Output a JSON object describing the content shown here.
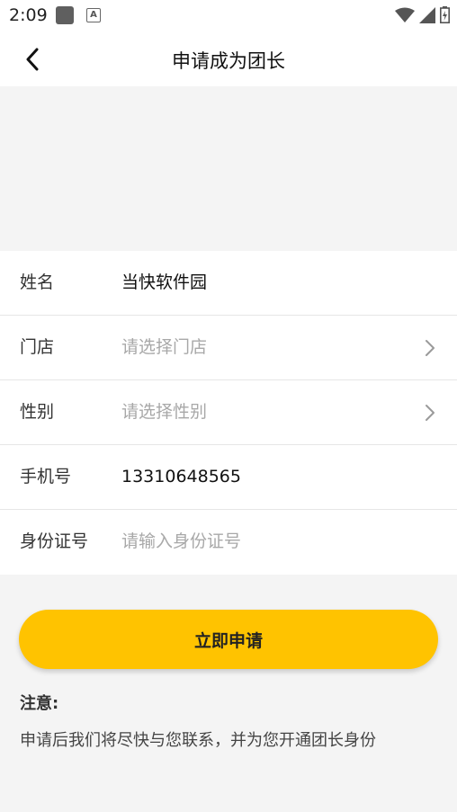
{
  "status": {
    "time": "2:09"
  },
  "header": {
    "title": "申请成为团长"
  },
  "form": {
    "name": {
      "label": "姓名",
      "value": "当快软件园"
    },
    "store": {
      "label": "门店",
      "placeholder": "请选择门店"
    },
    "gender": {
      "label": "性别",
      "placeholder": "请选择性别"
    },
    "phone": {
      "label": "手机号",
      "value": "13310648565"
    },
    "id_number": {
      "label": "身份证号",
      "placeholder": "请输入身份证号"
    }
  },
  "actions": {
    "apply_label": "立即申请"
  },
  "note": {
    "title": "注意:",
    "text": "申请后我们将尽快与您联系，并为您开通团长身份"
  },
  "colors": {
    "accent": "#ffc300",
    "background": "#f4f4f4",
    "placeholder": "#a8a8a8"
  }
}
